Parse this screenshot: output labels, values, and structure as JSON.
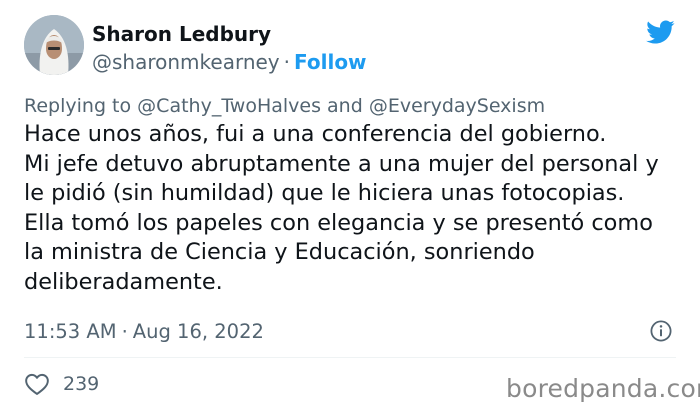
{
  "author": {
    "name": "Sharon Ledbury",
    "handle": "@sharonmkearney",
    "separator": "·",
    "follow_label": "Follow"
  },
  "reply": {
    "prefix": "Replying to",
    "mention_1": "@Cathy_TwoHalves",
    "conjunction": "and",
    "mention_2": "@EverydaySexism"
  },
  "tweet": {
    "lines": [
      "Hace unos años, fui a una conferencia del gobierno.",
      "Mi jefe detuvo abruptamente a una mujer del personal y",
      "le pidió (sin humildad) que le hiciera unas fotocopias.",
      "Ella tomó los papeles con elegancia y se presentó como",
      "la ministra de Ciencia y Educación, sonriendo",
      "deliberadamente."
    ]
  },
  "meta": {
    "time": "11:53 AM",
    "separator": "·",
    "date": "Aug 16, 2022"
  },
  "actions": {
    "like_count": "239"
  },
  "watermark": "boredpanda.com",
  "icons": {
    "brand": "twitter-bird-icon",
    "info": "info-icon",
    "like": "heart-icon"
  },
  "colors": {
    "accent": "#1d9bf0",
    "text": "#0f1419",
    "secondary": "#536471"
  }
}
